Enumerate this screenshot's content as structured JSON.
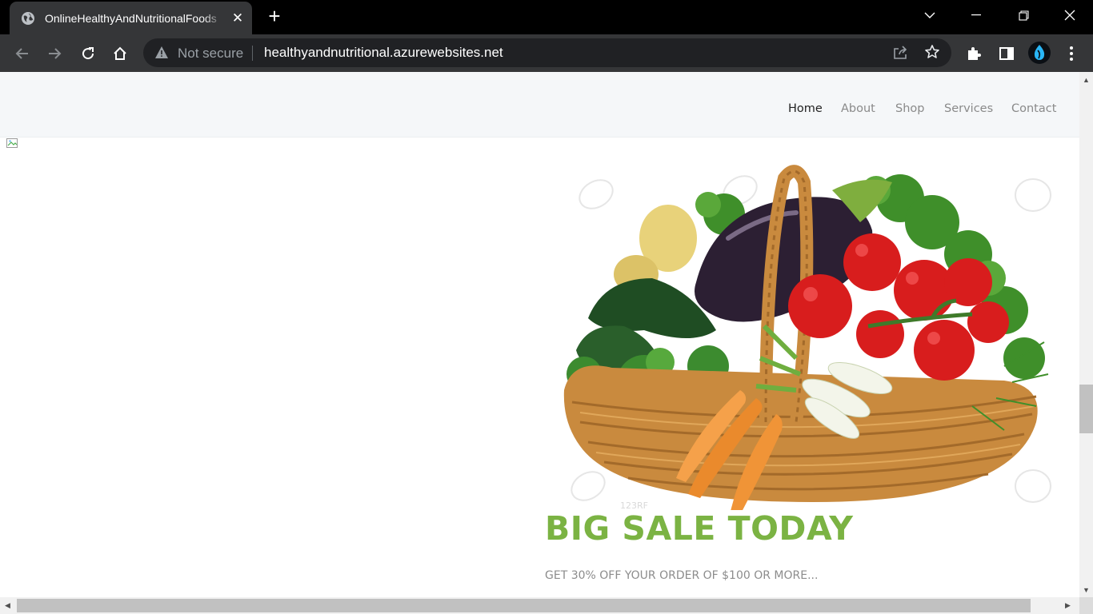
{
  "browser": {
    "tab_title": "OnlineHealthyAndNutritionalFoods",
    "security_label": "Not secure",
    "url": "healthyandnutritional.azurewebsites.net"
  },
  "nav": {
    "items": [
      {
        "label": "Home",
        "active": true
      },
      {
        "label": "About",
        "active": false
      },
      {
        "label": "Shop",
        "active": false
      },
      {
        "label": "Services",
        "active": false
      },
      {
        "label": "Contact",
        "active": false
      }
    ]
  },
  "hero": {
    "headline": "BIG SALE TODAY",
    "subline": "GET 30% OFF YOUR ORDER OF $100 OR MORE...",
    "image_description": "vegetable basket",
    "watermark_text": "123RF"
  },
  "colors": {
    "accent_green": "#7bb343",
    "tab_bg": "#353638",
    "omnibox_bg": "#202124",
    "navbar_bg": "#f5f7f9"
  }
}
